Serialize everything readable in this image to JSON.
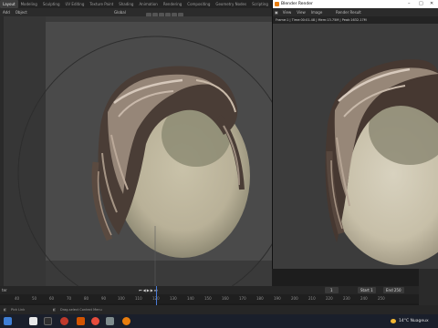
{
  "blender": {
    "workspace_tabs": [
      "Layout",
      "Modeling",
      "Sculpting",
      "UV Editing",
      "Texture Paint",
      "Shading",
      "Animation",
      "Rendering",
      "Compositing",
      "Geometry Nodes",
      "Scripting"
    ],
    "active_tab": "Layout",
    "toolbar": {
      "add": "Add",
      "object": "Object",
      "orientation": "Global"
    }
  },
  "render_window": {
    "title": "Blender Render",
    "menu": [
      "View",
      "View",
      "Image"
    ],
    "slot": "Render Result",
    "info": "Frame:1 | Time:00:01.48 | Mem:13.75M | Peak:1632.17M"
  },
  "timeline": {
    "label": "ter",
    "ruler_ticks": [
      "40",
      "50",
      "60",
      "70",
      "80",
      "90",
      "100",
      "110",
      "120",
      "130",
      "140",
      "150",
      "160",
      "170",
      "180",
      "190",
      "200",
      "210",
      "220",
      "230",
      "240",
      "250"
    ],
    "current_frame": "1",
    "start_label": "Start",
    "start_value": "1",
    "end_label": "End",
    "end_value": "250"
  },
  "statusbar": {
    "select": "Pick Link",
    "hint": "Drag-select Context Menu"
  },
  "taskbar": {
    "weather": "14°C",
    "location": "Nuageux"
  },
  "colors": {
    "accent": "#4a7bd6",
    "hair_dark": "#3b2f29",
    "hair_light": "#c3b3a3",
    "skin": "#d2cbb8",
    "scalp": "#7f7d68"
  }
}
